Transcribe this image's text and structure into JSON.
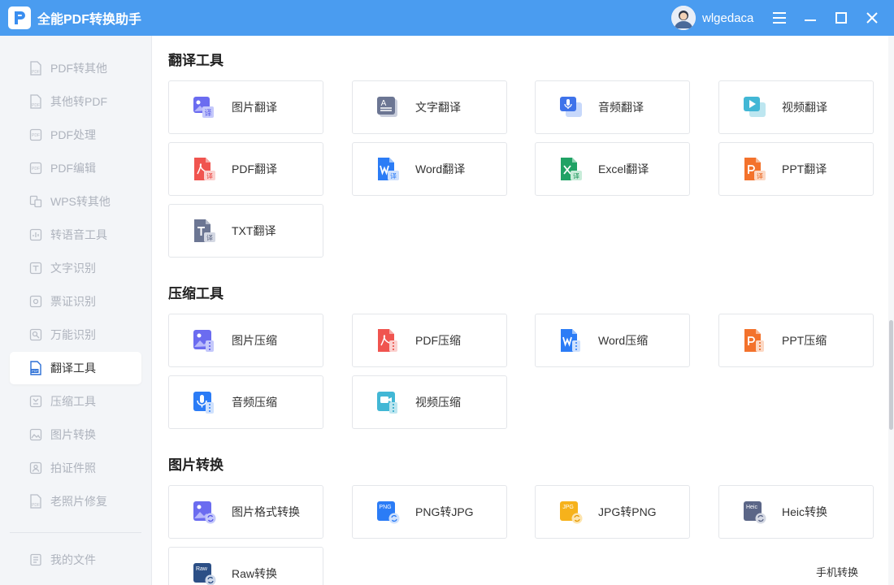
{
  "app": {
    "title": "全能PDF转换助手",
    "username": "wlgedaca"
  },
  "sidebar": {
    "items": [
      {
        "label": "PDF转其他",
        "icon": "pdf-file-icon"
      },
      {
        "label": "其他转PDF",
        "icon": "pdf-file-icon"
      },
      {
        "label": "PDF处理",
        "icon": "pdf-doc-icon"
      },
      {
        "label": "PDF编辑",
        "icon": "pdf-doc-icon"
      },
      {
        "label": "WPS转其他",
        "icon": "wps-icon"
      },
      {
        "label": "转语音工具",
        "icon": "voice-icon"
      },
      {
        "label": "文字识别",
        "icon": "text-ocr-icon"
      },
      {
        "label": "票证识别",
        "icon": "ticket-ocr-icon"
      },
      {
        "label": "万能识别",
        "icon": "universal-ocr-icon"
      },
      {
        "label": "翻译工具",
        "icon": "translate-icon"
      },
      {
        "label": "压缩工具",
        "icon": "compress-icon"
      },
      {
        "label": "图片转换",
        "icon": "image-convert-icon"
      },
      {
        "label": "拍证件照",
        "icon": "id-photo-icon"
      },
      {
        "label": "老照片修复",
        "icon": "photo-repair-icon"
      }
    ],
    "active_index": 9,
    "my_files": "我的文件"
  },
  "sections": [
    {
      "title": "翻译工具",
      "cards": [
        {
          "label": "图片翻译",
          "icon": "image-translate-icon"
        },
        {
          "label": "文字翻译",
          "icon": "text-translate-icon"
        },
        {
          "label": "音频翻译",
          "icon": "audio-translate-icon"
        },
        {
          "label": "视频翻译",
          "icon": "video-translate-icon"
        },
        {
          "label": "PDF翻译",
          "icon": "pdf-translate-icon"
        },
        {
          "label": "Word翻译",
          "icon": "word-translate-icon"
        },
        {
          "label": "Excel翻译",
          "icon": "excel-translate-icon"
        },
        {
          "label": "PPT翻译",
          "icon": "ppt-translate-icon"
        },
        {
          "label": "TXT翻译",
          "icon": "txt-translate-icon"
        }
      ]
    },
    {
      "title": "压缩工具",
      "cards": [
        {
          "label": "图片压缩",
          "icon": "image-compress-icon"
        },
        {
          "label": "PDF压缩",
          "icon": "pdf-compress-icon"
        },
        {
          "label": "Word压缩",
          "icon": "word-compress-icon"
        },
        {
          "label": "PPT压缩",
          "icon": "ppt-compress-icon"
        },
        {
          "label": "音频压缩",
          "icon": "audio-compress-icon"
        },
        {
          "label": "视频压缩",
          "icon": "video-compress-icon"
        }
      ]
    },
    {
      "title": "图片转换",
      "cards": [
        {
          "label": "图片格式转换",
          "icon": "image-format-convert-icon"
        },
        {
          "label": "PNG转JPG",
          "icon": "png-to-jpg-icon",
          "badge": "PNG"
        },
        {
          "label": "JPG转PNG",
          "icon": "jpg-to-png-icon",
          "badge": "JPG"
        },
        {
          "label": "Heic转换",
          "icon": "heic-convert-icon",
          "badge": "Heic"
        },
        {
          "label": "Raw转换",
          "icon": "raw-convert-icon",
          "badge": "Raw"
        }
      ]
    }
  ],
  "footer": {
    "phone_convert": "手机转换"
  },
  "colors": {
    "titlebar": "#4a9cf0",
    "pdf_red": "#f0544f",
    "word_blue": "#2b7cf6",
    "excel_green": "#20a265",
    "ppt_orange": "#f3722c",
    "purple": "#6b6cf0",
    "slate": "#6c7693",
    "jpg_yellow": "#f6b21b",
    "sidebar_bg": "#f3f5f8"
  }
}
